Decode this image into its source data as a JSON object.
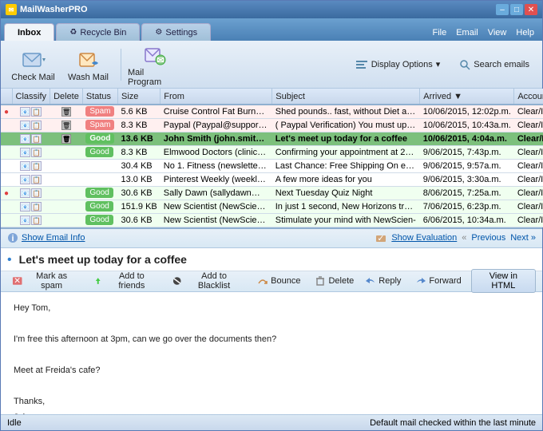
{
  "window": {
    "title": "MailWasherPRO",
    "controls": {
      "minimize": "–",
      "maximize": "□",
      "close": "✕"
    }
  },
  "tabs": [
    {
      "id": "inbox",
      "label": "Inbox",
      "active": true,
      "icon": ""
    },
    {
      "id": "recycle",
      "label": "Recycle Bin",
      "active": false,
      "icon": "♻"
    },
    {
      "id": "settings",
      "label": "Settings",
      "active": false,
      "icon": "⚙"
    }
  ],
  "menu": [
    "File",
    "Email",
    "View",
    "Help"
  ],
  "toolbar": {
    "check_mail": "Check Mail",
    "wash_mail": "Wash Mail",
    "mail_program": "Mail Program",
    "display_options": "Display Options",
    "search_emails": "Search emails"
  },
  "email_list": {
    "columns": [
      "Classify",
      "Delete",
      "Status",
      "Size",
      "From",
      "Subject",
      "Arrived",
      "Account"
    ],
    "rows": [
      {
        "dot": true,
        "classify": true,
        "delete": true,
        "status": "Spam",
        "status_type": "spam",
        "size": "5.6 KB",
        "from": "Cruise Control Fat Burner (cruise...",
        "subject": "Shed pounds.. fast, without Diet and ...",
        "arrived": "10/06/2015, 12:02p.m.",
        "account": "Clear/INBOX"
      },
      {
        "dot": false,
        "classify": true,
        "delete": true,
        "status": "Spam",
        "status_type": "spam",
        "size": "8.3 KB",
        "from": "Paypal (Paypal@support.com)",
        "subject": "( Paypal Verification) You must update...",
        "arrived": "10/06/2015, 10:43a.m.",
        "account": "Clear/INBOX"
      },
      {
        "dot": false,
        "classify": true,
        "delete": true,
        "status": "Good",
        "status_type": "good",
        "size": "13.6 KB",
        "from": "John Smith (john.smith@gigcom...",
        "subject": "Let's meet up today for a coffee",
        "arrived": "10/06/2015, 4:04a.m.",
        "account": "Clear/INBOX",
        "selected": true
      },
      {
        "dot": false,
        "classify": true,
        "delete": false,
        "status": "Good",
        "status_type": "good",
        "size": "8.3 KB",
        "from": "Elmwood Doctors (clinic@elmwo...",
        "subject": "Confirming your appointment at 2pm...",
        "arrived": "9/06/2015, 7:43p.m.",
        "account": "Clear/INBOX"
      },
      {
        "dot": false,
        "classify": true,
        "delete": false,
        "status": "",
        "status_type": "none",
        "size": "30.4 KB",
        "from": "No 1. Fitness (newsletter@no1fit...",
        "subject": "Last Chance: Free Shipping On every...",
        "arrived": "9/06/2015, 9:57a.m.",
        "account": "Clear/INBOX"
      },
      {
        "dot": false,
        "classify": true,
        "delete": false,
        "status": "",
        "status_type": "none",
        "size": "13.0 KB",
        "from": "Pinterest Weekly (weekly@explor...",
        "subject": "A few more ideas for you",
        "arrived": "9/06/2015, 3:30a.m.",
        "account": "Clear/INBOX"
      },
      {
        "dot": true,
        "classify": true,
        "delete": false,
        "status": "Good",
        "status_type": "good",
        "size": "30.6 KB",
        "from": "Sally Dawn (sallydawn@outlook.c...",
        "subject": "Next Tuesday Quiz Night",
        "arrived": "8/06/2015, 7:25a.m.",
        "account": "Clear/INBOX"
      },
      {
        "dot": false,
        "classify": true,
        "delete": false,
        "status": "Good",
        "status_type": "good",
        "size": "151.9 KB",
        "from": "New Scientist (NewScientist@e.n...",
        "subject": "In just 1 second, New Horizons travel...",
        "arrived": "7/06/2015, 6:23p.m.",
        "account": "Clear/INBOX"
      },
      {
        "dot": false,
        "classify": true,
        "delete": false,
        "status": "Good",
        "status_type": "good",
        "size": "30.6 KB",
        "from": "New Scientist (NewScientist@e.n...",
        "subject": "Stimulate your mind with NewScien-",
        "arrived": "6/06/2015, 10:34a.m.",
        "account": "Clear/INBOX"
      }
    ]
  },
  "preview": {
    "show_email_info": "Show Email Info",
    "show_evaluation": "Show Evaluation",
    "previous": "Previous",
    "next": "Next »",
    "subject": "Let's meet up today for a coffee",
    "actions": {
      "mark_as_spam": "Mark as spam",
      "add_to_friends": "Add to friends",
      "add_to_blacklist": "Add to Blacklist",
      "bounce": "Bounce",
      "delete": "Delete",
      "reply": "Reply",
      "forward": "Forward",
      "view_in_html": "View in HTML"
    },
    "body": [
      "Hey Tom,",
      "",
      "I'm free this afternoon at 3pm, can we go over the documents then?",
      "",
      "Meet at Freida's cafe?",
      "",
      "Thanks,",
      "John"
    ]
  },
  "status_bar": {
    "left": "Idle",
    "right": "Default mail checked within the last minute"
  }
}
